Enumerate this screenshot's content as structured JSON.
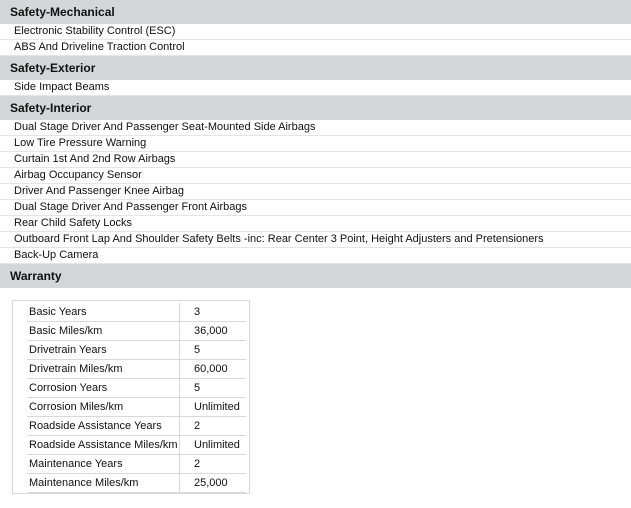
{
  "sections": [
    {
      "title": "Safety-Mechanical",
      "items": [
        "Electronic Stability Control (ESC)",
        "ABS And Driveline Traction Control"
      ]
    },
    {
      "title": "Safety-Exterior",
      "items": [
        "Side Impact Beams"
      ]
    },
    {
      "title": "Safety-Interior",
      "items": [
        "Dual Stage Driver And Passenger Seat-Mounted Side Airbags",
        "Low Tire Pressure Warning",
        "Curtain 1st And 2nd Row Airbags",
        "Airbag Occupancy Sensor",
        "Driver And Passenger Knee Airbag",
        "Dual Stage Driver And Passenger Front Airbags",
        "Rear Child Safety Locks",
        "Outboard Front Lap And Shoulder Safety Belts -inc: Rear Center 3 Point, Height Adjusters and Pretensioners",
        "Back-Up Camera"
      ]
    }
  ],
  "warranty": {
    "title": "Warranty",
    "rows": [
      {
        "label": "Basic Years",
        "value": "3"
      },
      {
        "label": "Basic Miles/km",
        "value": "36,000"
      },
      {
        "label": "Drivetrain Years",
        "value": "5"
      },
      {
        "label": "Drivetrain Miles/km",
        "value": "60,000"
      },
      {
        "label": "Corrosion Years",
        "value": "5"
      },
      {
        "label": "Corrosion Miles/km",
        "value": "Unlimited"
      },
      {
        "label": "Roadside Assistance Years",
        "value": "2"
      },
      {
        "label": "Roadside Assistance Miles/km",
        "value": "Unlimited"
      },
      {
        "label": "Maintenance Years",
        "value": "2"
      },
      {
        "label": "Maintenance Miles/km",
        "value": "25,000"
      }
    ]
  }
}
